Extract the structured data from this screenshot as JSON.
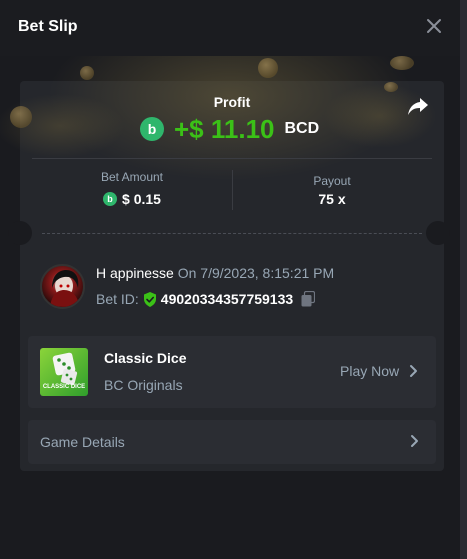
{
  "header": {
    "title": "Bet Slip"
  },
  "profit": {
    "label": "Profit",
    "amount": "+$ 11.10",
    "currency": "BCD",
    "coin_glyph": "b"
  },
  "stats": {
    "bet_amount_label": "Bet Amount",
    "bet_amount_value": "$ 0.15",
    "payout_label": "Payout",
    "payout_value": "75 x"
  },
  "user": {
    "name": "H appinesse",
    "date": "On 7/9/2023, 8:15:21 PM",
    "bet_id_label": "Bet ID:",
    "bet_id": "49020334357759133"
  },
  "game": {
    "name": "Classic Dice",
    "provider": "BC Originals",
    "thumb_text": "CLASSIC DICE",
    "play_label": "Play Now"
  },
  "details": {
    "label": "Game Details"
  },
  "colors": {
    "profit_green": "#3bc117",
    "muted_text": "#98a7b5",
    "card_bg": "#25272c",
    "page_bg": "#1b1c20",
    "coin_green": "#2fb66c"
  },
  "icons": [
    "close-icon",
    "share-icon",
    "bc-coin-icon",
    "verified-shield-icon",
    "copy-icon",
    "chevron-right-icon"
  ]
}
